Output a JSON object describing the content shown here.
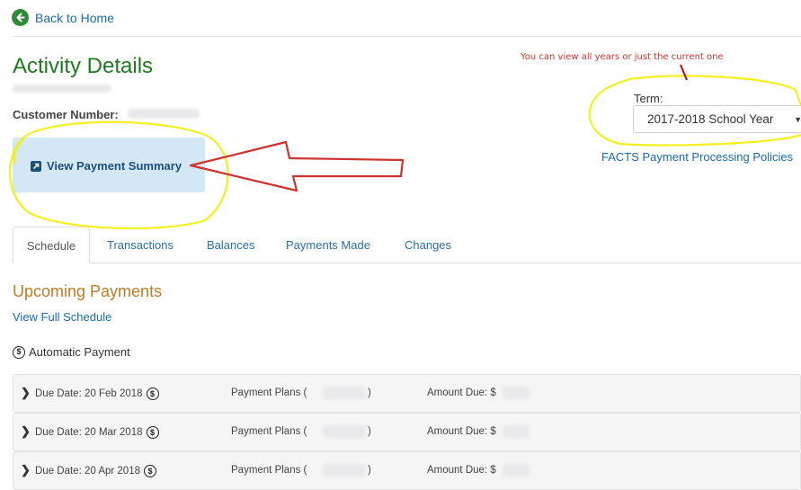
{
  "nav": {
    "back_label": "Back to Home"
  },
  "header": {
    "title": "Activity Details",
    "customer_label": "Customer Number:"
  },
  "summary": {
    "button_label": "View Payment Summary"
  },
  "annotation": {
    "note": "You can view all years or just the current one"
  },
  "term": {
    "label": "Term:",
    "selected": "2017-2018 School Year",
    "policies_link": "FACTS Payment Processing Policies"
  },
  "tabs": [
    {
      "label": "Schedule"
    },
    {
      "label": "Transactions"
    },
    {
      "label": "Balances"
    },
    {
      "label": "Payments Made"
    },
    {
      "label": "Changes"
    }
  ],
  "section": {
    "title": "Upcoming Payments",
    "full_schedule_link": "View Full Schedule",
    "automatic_label": "Automatic Payment"
  },
  "payments": [
    {
      "due": "Due Date: 20 Feb 2018",
      "plans": "Payment Plans (",
      "plans_close": ")",
      "amount": "Amount Due: $"
    },
    {
      "due": "Due Date: 20 Mar 2018",
      "plans": "Payment Plans (",
      "plans_close": ")",
      "amount": "Amount Due: $"
    },
    {
      "due": "Due Date: 20 Apr 2018",
      "plans": "Payment Plans (",
      "plans_close": ")",
      "amount": "Amount Due: $"
    }
  ],
  "icons": {
    "back": "arrow-left-circle-icon",
    "summary": "external-link-icon",
    "automatic": "dollar-cycle-icon",
    "row_expand": "chevron-right-icon"
  },
  "colors": {
    "title_green": "#1f7a1f",
    "link_blue": "#1a6aa8",
    "section_orange": "#c17a22",
    "summary_bg": "#d4e7f4",
    "annotation_red": "#d0312d",
    "highlight_yellow": "#f4f01f"
  }
}
